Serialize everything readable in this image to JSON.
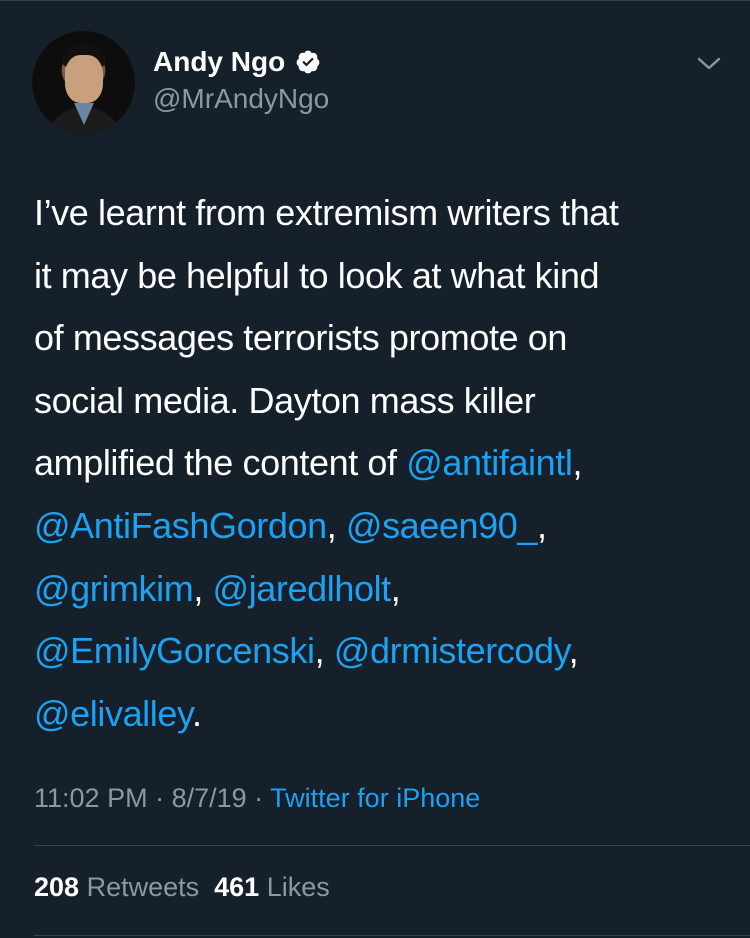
{
  "colors": {
    "background": "#15202b",
    "primary_text": "#ffffff",
    "secondary_text": "#8899a6",
    "accent": "#1da1f2",
    "divider": "#38444d"
  },
  "author": {
    "display_name": "Andy Ngo",
    "handle": "@MrAndyNgo",
    "verified": true,
    "verified_icon": "verified-badge-icon",
    "avatar": "avatar-photo"
  },
  "menu": {
    "icon": "chevron-down-icon"
  },
  "tweet": {
    "lines": [
      [
        {
          "text": "I’ve learnt from extremism writers that",
          "mention": false
        }
      ],
      [
        {
          "text": "it may be helpful to look at what kind",
          "mention": false
        }
      ],
      [
        {
          "text": "of messages terrorists promote on",
          "mention": false
        }
      ],
      [
        {
          "text": "social media. Dayton mass killer",
          "mention": false
        }
      ],
      [
        {
          "text": "amplified the content of ",
          "mention": false
        },
        {
          "text": "@antifaintl",
          "mention": true
        },
        {
          "text": ",",
          "mention": false
        }
      ],
      [
        {
          "text": "@AntiFashGordon",
          "mention": true
        },
        {
          "text": ", ",
          "mention": false
        },
        {
          "text": "@saeen90_",
          "mention": true
        },
        {
          "text": ",",
          "mention": false
        }
      ],
      [
        {
          "text": "@grimkim",
          "mention": true
        },
        {
          "text": ", ",
          "mention": false
        },
        {
          "text": "@jaredlholt",
          "mention": true
        },
        {
          "text": ",",
          "mention": false
        }
      ],
      [
        {
          "text": "@EmilyGorcenski",
          "mention": true
        },
        {
          "text": ", ",
          "mention": false
        },
        {
          "text": "@drmistercody",
          "mention": true
        },
        {
          "text": ",",
          "mention": false
        }
      ],
      [
        {
          "text": "@elivalley",
          "mention": true
        },
        {
          "text": ".",
          "mention": false
        }
      ]
    ]
  },
  "meta": {
    "time": "11:02 PM",
    "separator": " · ",
    "date": "8/7/19",
    "source": "Twitter for iPhone"
  },
  "stats": {
    "retweets_count": "208",
    "retweets_label": " Retweets",
    "likes_count": "461",
    "likes_label": " Likes"
  }
}
